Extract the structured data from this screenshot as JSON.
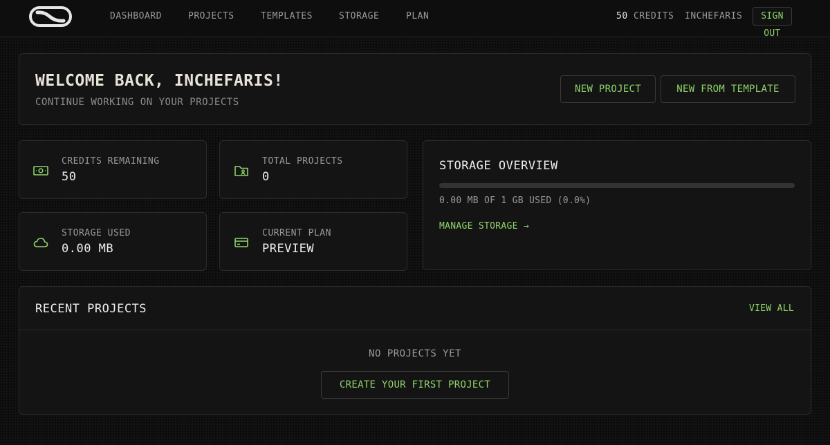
{
  "nav": {
    "logo": "logo-icon",
    "items": [
      "DASHBOARD",
      "PROJECTS",
      "TEMPLATES",
      "STORAGE",
      "PLAN"
    ],
    "credits_value": "50",
    "credits_label": "CREDITS",
    "username": "INCHEFARIS",
    "signout": "SIGN OUT"
  },
  "welcome": {
    "title": "WELCOME BACK, INCHEFARIS!",
    "subtitle": "CONTINUE WORKING ON YOUR PROJECTS",
    "new_project": "NEW PROJECT",
    "new_from_template": "NEW FROM TEMPLATE"
  },
  "stats": [
    {
      "label": "CREDITS REMAINING",
      "value": "50",
      "icon": "money-icon"
    },
    {
      "label": "TOTAL PROJECTS",
      "value": "0",
      "icon": "folder-user-icon"
    },
    {
      "label": "STORAGE USED",
      "value": "0.00 MB",
      "icon": "cloud-icon"
    },
    {
      "label": "CURRENT PLAN",
      "value": "PREVIEW",
      "icon": "credit-card-icon"
    }
  ],
  "storage": {
    "title": "STORAGE OVERVIEW",
    "used_fraction": 0.0,
    "usage_text": "0.00 MB OF 1 GB USED (0.0%)",
    "manage_link": "MANAGE STORAGE →"
  },
  "recent": {
    "title": "RECENT PROJECTS",
    "view_all": "VIEW ALL",
    "empty_text": "NO PROJECTS YET",
    "create_button": "CREATE YOUR FIRST PROJECT"
  },
  "colors": {
    "accent": "#8fd36a",
    "background": "#0d0d0d",
    "card": "#141414",
    "border": "#2c2c2c"
  }
}
